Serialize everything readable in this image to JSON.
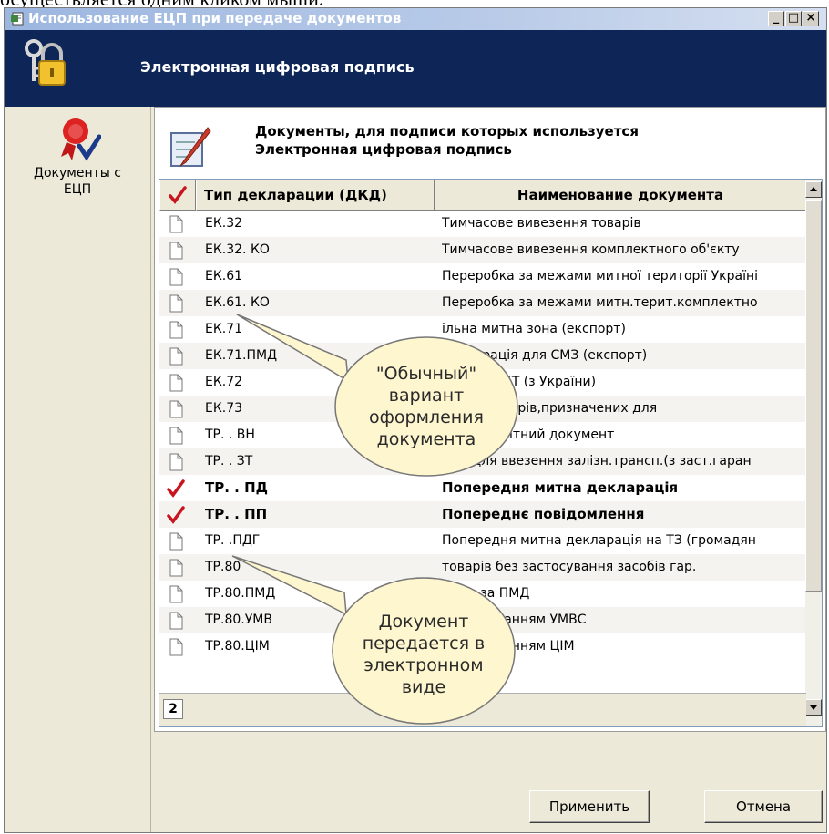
{
  "top_caption": "осуществляется одним кликом мыши.",
  "window": {
    "title": "Использование ЕЦП при передаче документов",
    "buttons": {
      "minimize": "_",
      "maximize": "□",
      "close": "×"
    }
  },
  "header": {
    "title": "Электронная цифровая подпись"
  },
  "sidebar": {
    "item_label_line1": "Документы с",
    "item_label_line2": "ЕЦП"
  },
  "panel": {
    "title_line1": "Документы, для подписи которых используется",
    "title_line2": "Электронная цифровая подпись"
  },
  "grid": {
    "columns": [
      "Тип декларации (ДКД)",
      "Наименование документа"
    ],
    "rows": [
      {
        "type": "ЕК.32",
        "name": "Тимчасове вивезення товарів",
        "checked": false
      },
      {
        "type": "ЕК.32. КО",
        "name": "Тимчасове вивезення комплектного об'єкту",
        "checked": false
      },
      {
        "type": "ЕК.61",
        "name": "Переробка за межами митної території Україні",
        "checked": false
      },
      {
        "type": "ЕК.61. КО",
        "name": "Переробка за межами митн.терит.комплектно",
        "checked": false
      },
      {
        "type": "ЕК.71",
        "name": "ільна митна зона (експорт)",
        "checked": false
      },
      {
        "type": "ЕК.71.ПМД",
        "name": "декларація для СМЗ (експорт)",
        "checked": false
      },
      {
        "type": "ЕК.72",
        "name": "варів в МБТ (з України)",
        "checked": false
      },
      {
        "type": "ЕК.73",
        "name": "а МЛС товарів,призначених для",
        "checked": false
      },
      {
        "type": "ТР. . ВН",
        "name": "ній транзитний документ",
        "checked": false
      },
      {
        "type": "ТР. . ЗТ",
        "name": "ВТД для ввезення залізн.трансп.(з заст.гаран",
        "checked": false
      },
      {
        "type": "ТР. . ПД",
        "name": "Попередня митна декларація",
        "checked": true
      },
      {
        "type": "ТР. . ПП",
        "name": "Попереднє повідомлення",
        "checked": true
      },
      {
        "type": "ТР. .ПДГ",
        "name": "Попередня митна декларація на ТЗ (громадян",
        "checked": false
      },
      {
        "type": "ТР.80",
        "name": "товарів без застосування засобів гар.",
        "checked": false
      },
      {
        "type": "ТР.80.ПМД",
        "name": "варів за ПМД",
        "checked": false
      },
      {
        "type": "ТР.80.УМВ",
        "name": "використанням УМВС",
        "checked": false
      },
      {
        "type": "ТР.80.ЦІМ",
        "name": "використанням ЦІМ",
        "checked": false
      }
    ],
    "selected_count": "2"
  },
  "buttons": {
    "apply": "Применить",
    "cancel": "Отмена"
  },
  "callouts": {
    "ordinary": [
      "\"Обычный\"",
      "вариант",
      "оформления",
      "документа"
    ],
    "electronic": [
      "Документ",
      "передается в",
      "электронном",
      "виде"
    ]
  },
  "colors": {
    "header_bg": "#0d2557",
    "check_red": "#c8141e",
    "callout_fill": "#fdf6cf"
  }
}
